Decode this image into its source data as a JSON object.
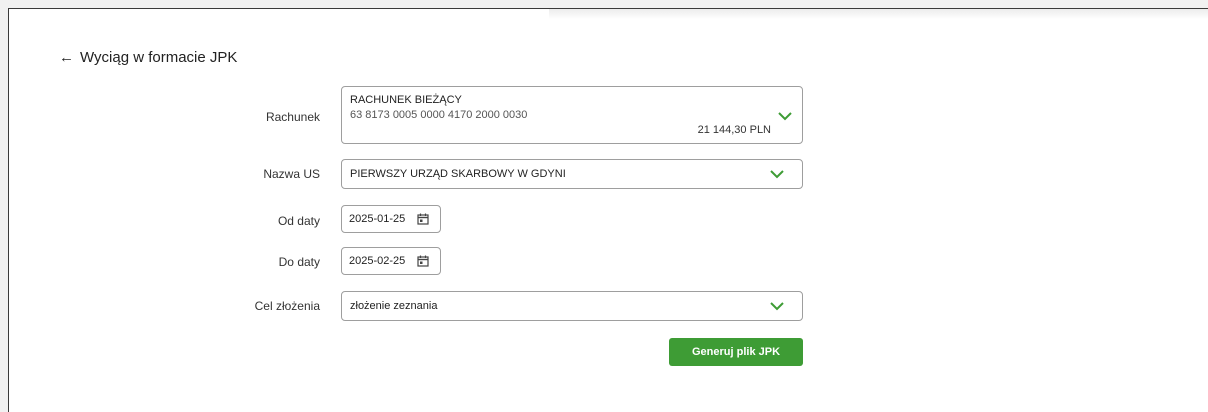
{
  "header": {
    "back_arrow": "←",
    "title": "Wyciąg w formacie JPK"
  },
  "form": {
    "account": {
      "label": "Rachunek",
      "name": "RACHUNEK BIEŻĄCY",
      "number": "63 8173 0005 0000 4170 2000 0030",
      "balance": "21 144,30 PLN"
    },
    "tax_office": {
      "label": "Nazwa US",
      "value": "PIERWSZY URZĄD SKARBOWY W GDYNI"
    },
    "date_from": {
      "label": "Od daty",
      "value": "2025-01-25"
    },
    "date_to": {
      "label": "Do daty",
      "value": "2025-02-25"
    },
    "purpose": {
      "label": "Cel złożenia",
      "value": "złożenie zeznania"
    },
    "submit_label": "Generuj plik JPK"
  },
  "colors": {
    "accent": "#3e9c35",
    "chevron": "#3e9c35",
    "border": "#9e9e9e"
  },
  "icons": {
    "chevron": "chevron-down-icon",
    "calendar": "calendar-icon",
    "back": "arrow-left-icon"
  }
}
